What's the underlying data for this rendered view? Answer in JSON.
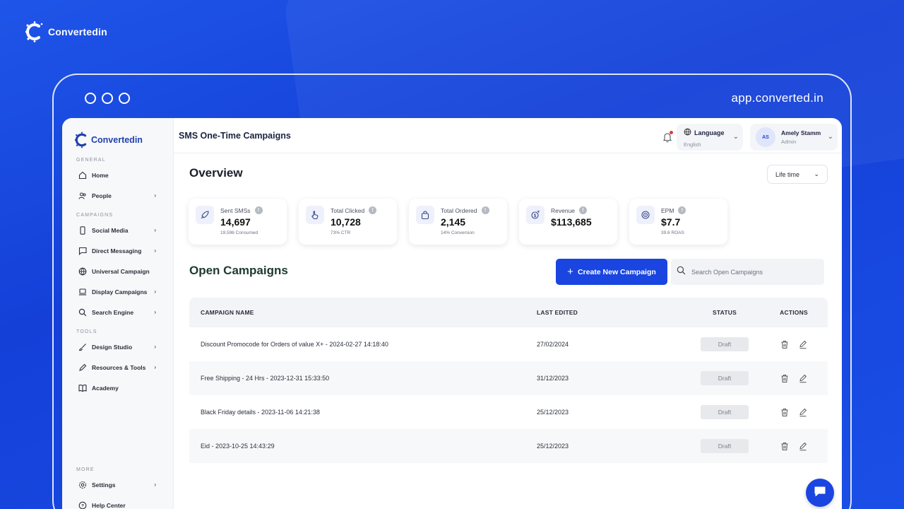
{
  "brand": {
    "name": "Convertedin"
  },
  "browser": {
    "url": "app.converted.in"
  },
  "sidebar": {
    "brand_name": "Convertedin",
    "sections": {
      "general": "GENERAL",
      "campaigns": "CAMPAIGNS",
      "tools": "TOOLS",
      "more": "MORE"
    },
    "items": [
      {
        "label": "Home",
        "icon": "home-icon"
      },
      {
        "label": "People",
        "icon": "people-icon"
      },
      {
        "label": "Social Media",
        "icon": "phone-icon"
      },
      {
        "label": "Direct Messaging",
        "icon": "message-icon"
      },
      {
        "label": "Universal Campaign",
        "icon": "globe-icon"
      },
      {
        "label": "Display Campaigns",
        "icon": "laptop-icon"
      },
      {
        "label": "Search Engine",
        "icon": "search-icon"
      },
      {
        "label": "Design Studio",
        "icon": "brush-icon"
      },
      {
        "label": "Resources & Tools",
        "icon": "pen-icon"
      },
      {
        "label": "Academy",
        "icon": "book-icon"
      },
      {
        "label": "Settings",
        "icon": "gear-icon"
      },
      {
        "label": "Help Center",
        "icon": "help-icon"
      }
    ]
  },
  "header": {
    "title": "SMS One-Time Campaigns",
    "language_label": "Language",
    "language_value": "English",
    "user_initials": "AS",
    "user_name": "Amely Stamm",
    "user_role": "Admin"
  },
  "overview": {
    "title": "Overview",
    "range": "Life time",
    "stats": [
      {
        "label": "Sent SMSs",
        "value": "14,697",
        "sub": "19,596 Consumed",
        "icon": "rocket-icon"
      },
      {
        "label": "Total Clicked",
        "value": "10,728",
        "sub": "73% CTR",
        "icon": "pointer-icon"
      },
      {
        "label": "Total Ordered",
        "value": "2,145",
        "sub": "14% Conversion",
        "icon": "bag-icon"
      },
      {
        "label": "Revenue",
        "value": "$113,685",
        "sub": "",
        "icon": "money-icon"
      },
      {
        "label": "EPM",
        "value": "$7.7",
        "sub": "39.6 ROAS",
        "icon": "target-icon"
      }
    ]
  },
  "campaigns": {
    "title": "Open Campaigns",
    "create_label": "Create New Campaign",
    "search_placeholder": "Search Open Campaigns",
    "columns": {
      "name": "CAMPAIGN NAME",
      "edited": "LAST EDITED",
      "status": "STATUS",
      "actions": "ACTIONS"
    },
    "rows": [
      {
        "name": "Discount Promocode for Orders of value X+ - 2024-02-27 14:18:40",
        "edited": "27/02/2024",
        "status": "Draft"
      },
      {
        "name": "Free Shipping - 24 Hrs - 2023-12-31 15:33:50",
        "edited": "31/12/2023",
        "status": "Draft"
      },
      {
        "name": "Black Friday details - 2023-11-06 14:21:38",
        "edited": "25/12/2023",
        "status": "Draft"
      },
      {
        "name": "Eid - 2023-10-25 14:43:29",
        "edited": "25/12/2023",
        "status": "Draft"
      }
    ]
  },
  "colors": {
    "primary": "#1a45e0",
    "background": "#1440d8"
  }
}
